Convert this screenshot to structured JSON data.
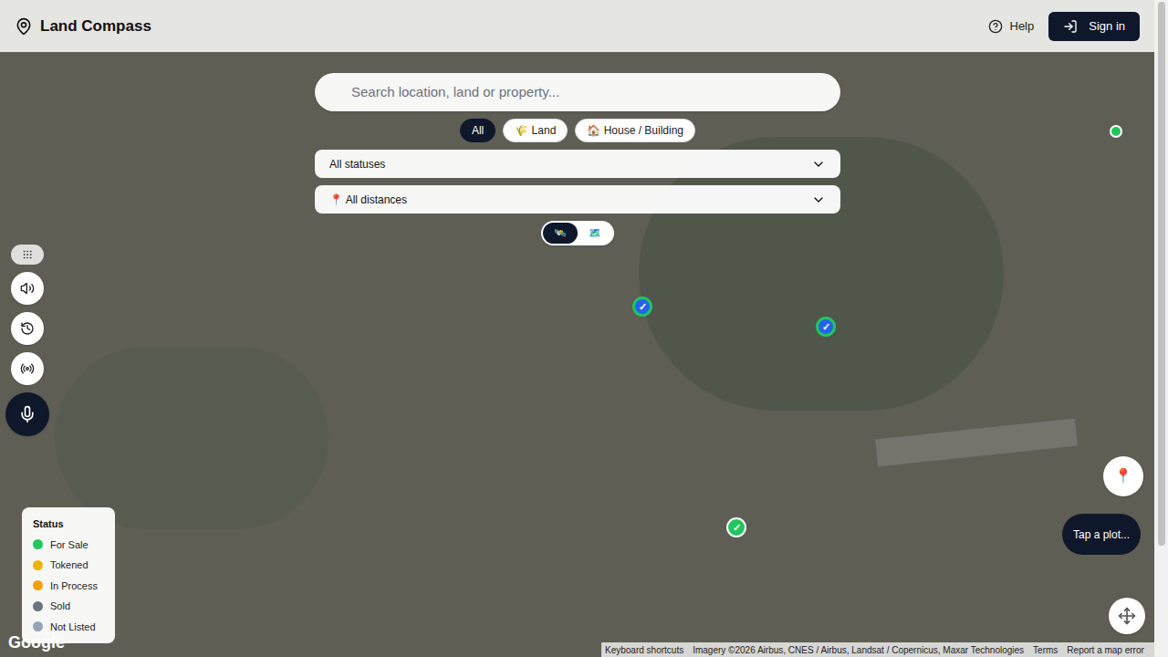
{
  "header": {
    "title": "Land Compass",
    "help": "Help",
    "sign_in": "Sign in"
  },
  "search": {
    "placeholder": "Search location, land or property..."
  },
  "type_filters": [
    {
      "label": "All",
      "selected": true
    },
    {
      "label": "🌾 Land",
      "selected": false
    },
    {
      "label": "🏠 House / Building",
      "selected": false
    }
  ],
  "status_select": {
    "value": "All statuses"
  },
  "distance_select": {
    "value": "📍 All distances"
  },
  "map_type_toggle": [
    {
      "label": "🛰️",
      "selected": true
    },
    {
      "label": "🗺️",
      "selected": false
    }
  ],
  "legend": {
    "title": "Status",
    "items": [
      {
        "label": "For Sale",
        "color": "#22c55e"
      },
      {
        "label": "Tokened",
        "color": "#eab308"
      },
      {
        "label": "In Process",
        "color": "#f59e0b"
      },
      {
        "label": "Sold",
        "color": "#6b7280"
      },
      {
        "label": "Not Listed",
        "color": "#94a3b8"
      }
    ]
  },
  "pins": [
    {
      "status": "For Sale",
      "color": "#22c55e",
      "kind": "verified",
      "mark": "✓"
    },
    {
      "status": "For Sale",
      "color": "#22c55e",
      "kind": "verified",
      "mark": "✓"
    },
    {
      "status": "For Sale",
      "color": "#22c55e",
      "kind": "check",
      "mark": "✓"
    },
    {
      "status": "For Sale",
      "color": "#22c55e",
      "kind": "dot",
      "mark": ""
    }
  ],
  "locate_button": {
    "label": "📍"
  },
  "hint": "Tap a plot...",
  "map_footer": {
    "logo": "Google",
    "links": [
      "Keyboard shortcuts",
      "Imagery ©2026 Airbus, CNES / Airbus, Landsat / Copernicus, Maxar Technologies",
      "Terms",
      "Report a map error"
    ]
  }
}
